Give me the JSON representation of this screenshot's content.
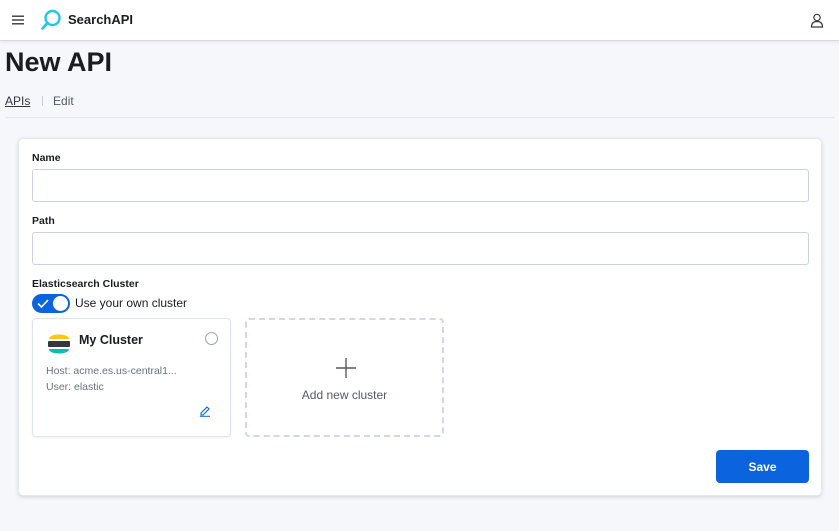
{
  "header": {
    "brand": "SearchAPI"
  },
  "page": {
    "title": "New API",
    "breadcrumb": {
      "link": "APIs",
      "current": "Edit"
    }
  },
  "form": {
    "name": {
      "label": "Name",
      "value": "",
      "placeholder": ""
    },
    "path": {
      "label": "Path",
      "value": "",
      "placeholder": ""
    },
    "cluster_section": {
      "label": "Elasticsearch Cluster",
      "toggle_label": "Use your own cluster",
      "toggle_on": true
    },
    "cluster_card": {
      "name": "My Cluster",
      "host": "Host: acme.es.us-central1...",
      "user": "User: elastic",
      "selected": false
    },
    "add_cluster": {
      "label": "Add new cluster"
    },
    "save_label": "Save"
  },
  "icons": {
    "menu": "menu-icon",
    "logo": "search-logo-icon",
    "user": "user-icon",
    "cluster": "elasticsearch-logo-icon",
    "edit": "pencil-icon",
    "add": "plus-icon",
    "toggle_check": "check-icon"
  },
  "colors": {
    "primary": "#0b64dd",
    "logo_cyan": "#20c6e9",
    "page_bg": "#f5f7fa",
    "es_yellow": "#fec514",
    "es_teal": "#00bfb3",
    "es_dark": "#343741"
  }
}
